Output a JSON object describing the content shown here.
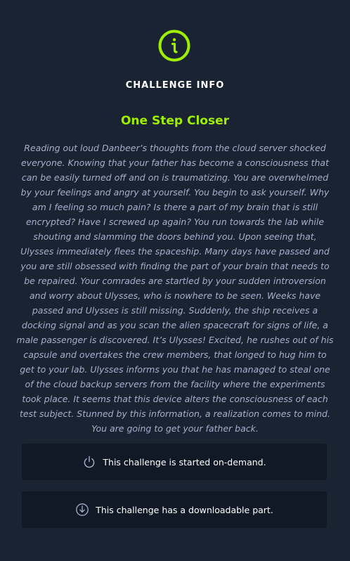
{
  "header": {
    "icon": "info-circle-icon",
    "heading": "CHALLENGE INFO"
  },
  "challenge": {
    "title": "One Step Closer",
    "description": "Reading out loud Danbeer’s thoughts from the cloud server shocked everyone. Knowing that your father has become a consciousness that can be easily turned off and on is traumatizing. You are overwhelmed by your feelings and angry at yourself. You begin to ask yourself. Why am I feeling so much pain? Is there a part of my brain that is still encrypted? Have I screwed up again? You run towards the lab while shouting and slamming the doors behind you. Upon seeing that, Ulysses immediately flees the spaceship. Many days have passed and you are still obsessed with finding the part of your brain that needs to be repaired. Your comrades are startled by your sudden introversion and worry about Ulysses, who is nowhere to be seen. Weeks have passed and Ulysses is still missing. Suddenly, the ship receives a docking signal and as you scan the alien spacecraft for signs of life, a male passenger is discovered. It’s Ulysses! Excited, he rushes out of his capsule and overtakes the crew members, that longed to hug him to get to your lab. Ulysses informs you that he has managed to steal one of the cloud backup servers from the facility where the experiments took place. It seems that this device alters the consciousness of each test subject. Stunned by this information, a realization comes to mind. You are going to get your father back."
  },
  "notices": {
    "on_demand": {
      "icon": "power-icon",
      "text": "This challenge is started on-demand."
    },
    "download": {
      "icon": "download-icon",
      "text": "This challenge has a downloadable part."
    }
  },
  "colors": {
    "background": "#1a2332",
    "accent": "#9fef00",
    "card": "#111927",
    "body_text": "#a4b1cd"
  }
}
